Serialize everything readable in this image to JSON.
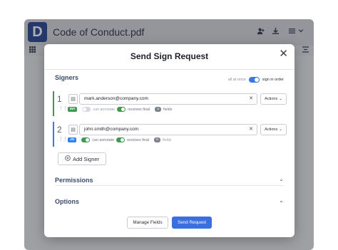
{
  "app": {
    "logo_letter": "D",
    "title": "Code of Conduct.pdf",
    "header_icons": [
      "add-user-icon",
      "download-icon",
      "menu-icon",
      "chevron-down-icon"
    ],
    "toolbar_icons": [
      "grid-icon",
      "align-icon"
    ]
  },
  "modal": {
    "title": "Send Sign Request",
    "close_glyph": "✕",
    "signers_section": {
      "label": "Signers",
      "order_options": [
        "all at once",
        "sign in order"
      ],
      "order_selected": "sign in order"
    },
    "signers": [
      {
        "number": "1",
        "email": "mark.anderson@company.com",
        "actions_label": "Actions",
        "initials": "MA",
        "can_annotate_label": "can annotate",
        "can_annotate": false,
        "receives_final_label": "receives final",
        "receives_final": true,
        "field_count": "4",
        "fields_label": "fields",
        "accent_color": "#3e9a4e",
        "badge_bg": "#3e9a4e",
        "badge_fg": "#ffffff"
      },
      {
        "number": "2",
        "email": "john.smith@company.com",
        "actions_label": "Actions",
        "initials": "JO",
        "can_annotate_label": "can annotate",
        "can_annotate": true,
        "receives_final_label": "receives final",
        "receives_final": true,
        "field_count": "0",
        "fields_label": "fields",
        "accent_color": "#2f80ed",
        "badge_bg": "#2f80ed",
        "badge_fg": "#ffffff"
      }
    ],
    "add_signer_label": "Add Signer",
    "permissions_label": "Permissions",
    "options_label": "Options",
    "manage_fields_label": "Manage Fields",
    "send_request_label": "Send Request",
    "colors": {
      "primary": "#3a6fe0",
      "toggle_on": "#3e9a4e",
      "section_heading": "#3b4a6b"
    }
  }
}
